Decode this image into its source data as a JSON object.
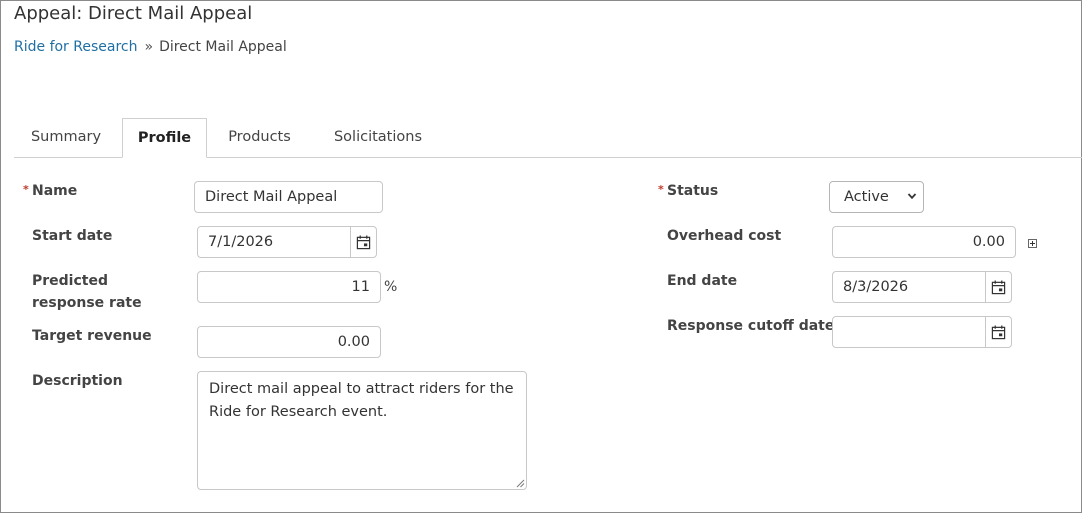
{
  "header": {
    "title": "Appeal: Direct Mail Appeal"
  },
  "breadcrumb": {
    "parent": "Ride for Research",
    "separator": "»",
    "current": "Direct Mail Appeal"
  },
  "tabs": [
    {
      "label": "Summary",
      "active": false
    },
    {
      "label": "Profile",
      "active": true
    },
    {
      "label": "Products",
      "active": false
    },
    {
      "label": "Solicitations",
      "active": false
    }
  ],
  "form": {
    "required_marker": "*",
    "name": {
      "label": "Name",
      "value": "Direct Mail Appeal"
    },
    "start_date": {
      "label": "Start date",
      "value": "7/1/2026"
    },
    "response_rate": {
      "label": "Predicted response rate",
      "value": "11",
      "unit": "%"
    },
    "target_revenue": {
      "label": "Target revenue",
      "value": "0.00"
    },
    "description": {
      "label": "Description",
      "value": "Direct mail appeal to attract riders for the Ride for Research event."
    },
    "status": {
      "label": "Status",
      "value": "Active"
    },
    "overhead_cost": {
      "label": "Overhead cost",
      "value": "0.00"
    },
    "end_date": {
      "label": "End date",
      "value": "8/3/2026"
    },
    "cutoff_date": {
      "label": "Response cutoff date",
      "value": ""
    }
  },
  "icons": {
    "calendar": "calendar-icon",
    "expand": "expand-plus-icon",
    "chevron": "chevron-down-icon"
  }
}
